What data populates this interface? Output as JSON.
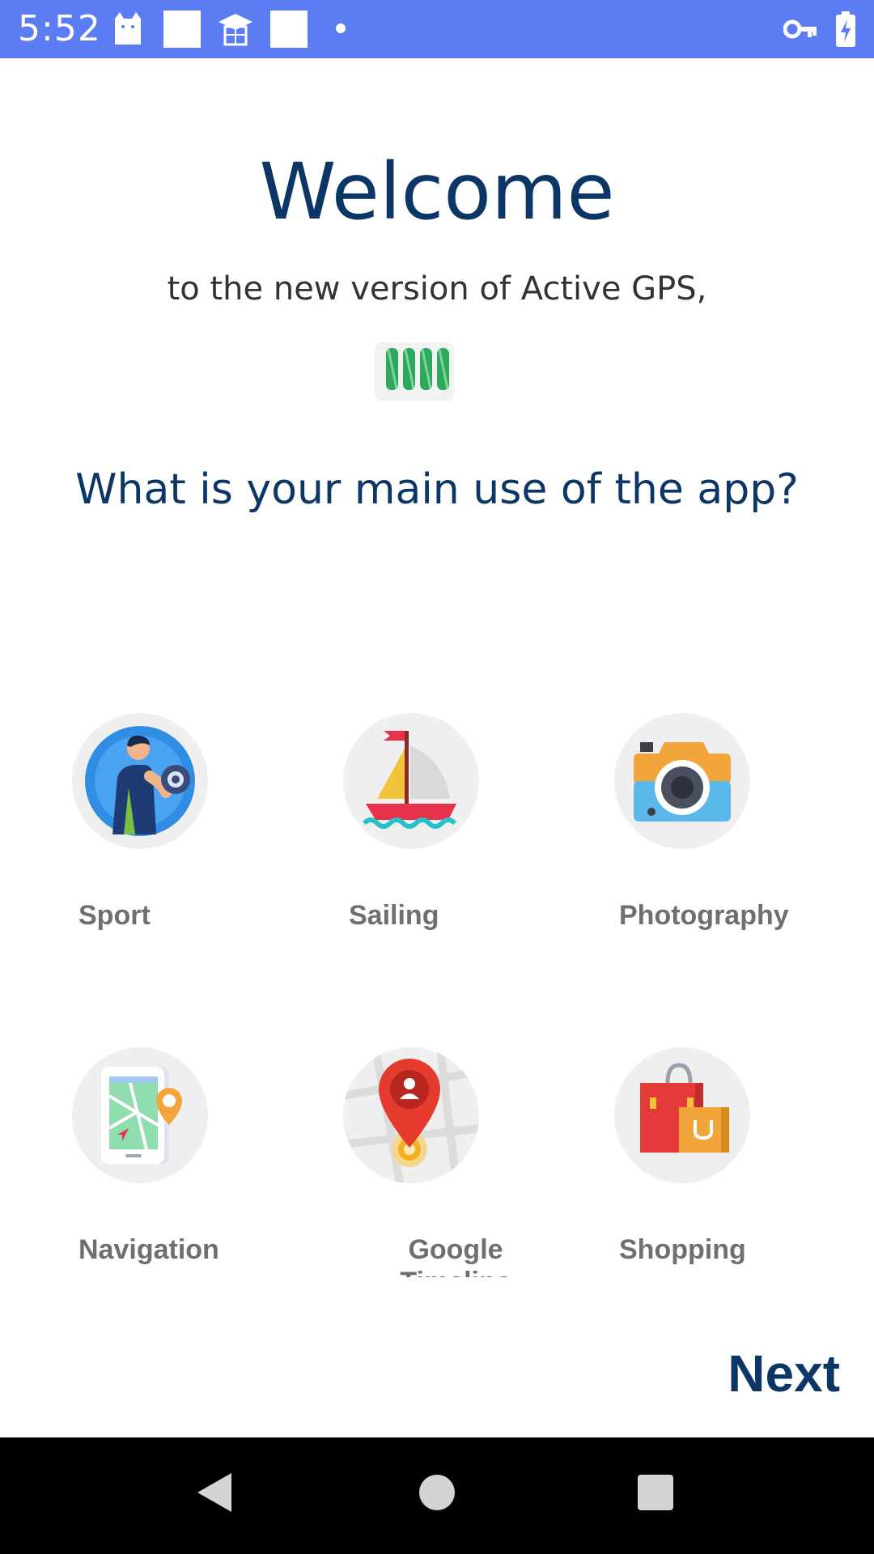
{
  "status_bar": {
    "time": "5:52",
    "left_icons": [
      "cat-notification-icon",
      "white-square-icon",
      "graduation-cap-icon",
      "white-square-icon",
      "dot-icon"
    ],
    "right_icons": [
      "vpn-key-icon",
      "battery-charging-icon"
    ]
  },
  "welcome": {
    "title": "Welcome",
    "subtitle": "to the new version of Active GPS,",
    "question": "What is your main use of the app?"
  },
  "options": [
    {
      "label": "Sport",
      "icon": "sport-dumbbell-icon"
    },
    {
      "label": "Sailing",
      "icon": "sailboat-icon"
    },
    {
      "label": "Photography",
      "icon": "camera-icon"
    },
    {
      "label": "Navigation",
      "icon": "map-phone-icon"
    },
    {
      "label": "Google Timeline",
      "icon": "location-pin-icon"
    },
    {
      "label": "Shopping",
      "icon": "shopping-bags-icon"
    }
  ],
  "next_label": "Next",
  "colors": {
    "status_bar": "#5b7cf2",
    "heading": "#0c3666",
    "option_label": "#6f6f6f",
    "circle_bg": "#efefef"
  },
  "nav_bar": {
    "buttons": [
      "back-icon",
      "home-icon",
      "recents-icon"
    ]
  }
}
